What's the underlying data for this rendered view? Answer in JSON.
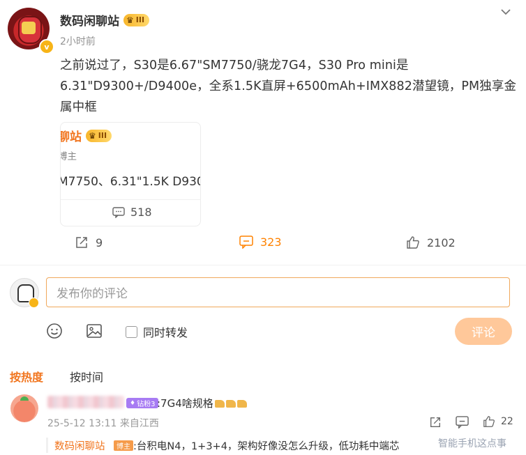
{
  "post": {
    "username": "数码闲聊站",
    "level_badge": "III",
    "time": "2小时前",
    "text_line1": "之前说过了，S30是6.67\"SM7750/骁龙7G4，S30 Pro mini是",
    "text_line2": "6.31\"D9300+/D9400e，全系1.5K直屏+6500mAh+IMX882潜望镜，PM独享金",
    "text_line3": "属中框"
  },
  "card": {
    "name": "聊站",
    "level_badge": "III",
    "role": "博主",
    "text": "M7750、6.31\"1.5K D930",
    "comment_count": "518"
  },
  "actions": {
    "share_count": "9",
    "comment_count": "323",
    "like_count": "2102"
  },
  "composer": {
    "placeholder": "发布你的评论",
    "repost_label": "同时转发",
    "submit_label": "评论"
  },
  "sort": {
    "hot_label": "按热度",
    "time_label": "按时间"
  },
  "comment": {
    "fan_badge": "钻粉3",
    "text": ":7G4啥规格",
    "meta": "25-5-12 13:11 来自江西",
    "like_count": "22"
  },
  "reply": {
    "name": "数码闲聊站",
    "badge": "博主",
    "text": ":台积电N4，1+3+4，架构好像没怎么升级，低功耗中端芯"
  },
  "watermark": "智能手机这点事",
  "colors": {
    "accent": "#ff8200",
    "brand_orange": "#f1751e",
    "submit_disabled": "#ffc89a",
    "input_border": "#f0a85b"
  },
  "icons": [
    "chevron-down-icon",
    "comment-icon",
    "share-icon",
    "like-icon",
    "emoji-icon",
    "image-icon",
    "crown-icon",
    "verified-icon"
  ]
}
